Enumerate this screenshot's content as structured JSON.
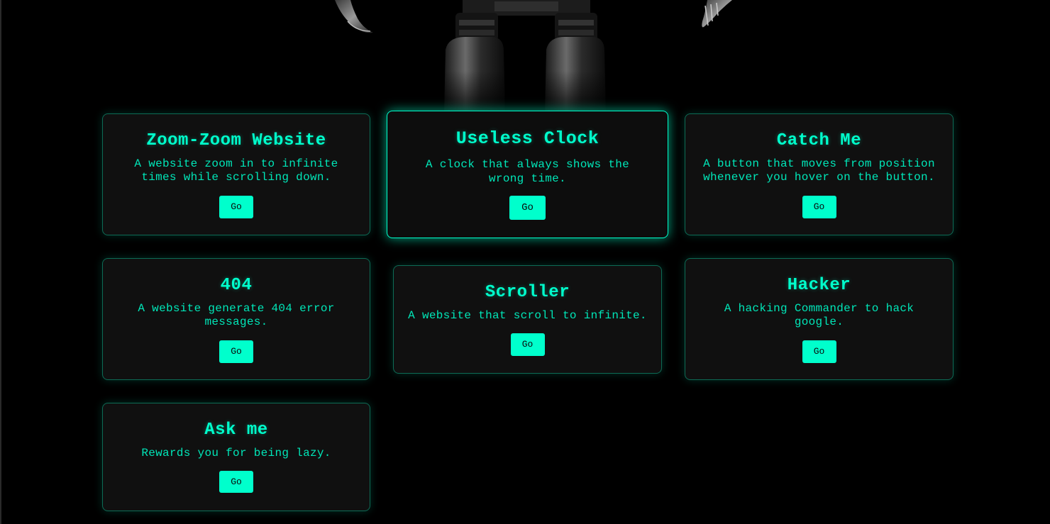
{
  "cards": [
    {
      "title": "Zoom-Zoom Website",
      "description": "A website zoom in to infinite times while scrolling down.",
      "button": "Go"
    },
    {
      "title": "Useless Clock",
      "description": "A clock that always shows the wrong time.",
      "button": "Go"
    },
    {
      "title": "Catch Me",
      "description": "A button that moves from position whenever you hover on the button.",
      "button": "Go"
    },
    {
      "title": "404",
      "description": "A website generate 404 error messages.",
      "button": "Go"
    },
    {
      "title": "Scroller",
      "description": "A website that scroll to infinite.",
      "button": "Go"
    },
    {
      "title": "Hacker",
      "description": "A hacking Commander to hack google.",
      "button": "Go"
    },
    {
      "title": "Ask me",
      "description": "Rewards you for being lazy.",
      "button": "Go"
    }
  ],
  "colors": {
    "accent": "#00ffcc",
    "background": "#000000",
    "card": "#101010"
  }
}
